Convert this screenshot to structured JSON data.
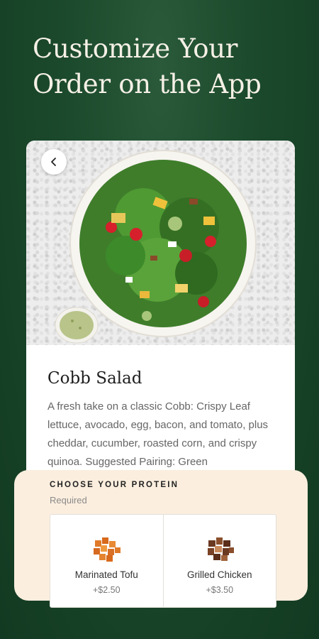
{
  "headline": {
    "line1": "Customize Your",
    "line2": "Order on the App"
  },
  "product": {
    "name": "Cobb Salad",
    "description": "A fresh take on a classic Cobb: Crispy Leaf lettuce, avocado, egg, bacon, and tomato, plus cheddar, cucumber, roasted corn, and crispy quinoa. Suggested Pairing: Green"
  },
  "protein_sheet": {
    "title": "CHOOSE YOUR PROTEIN",
    "required_label": "Required",
    "options": [
      {
        "name": "Marinated Tofu",
        "price": "+$2.50",
        "icon": "tofu-icon"
      },
      {
        "name": "Grilled Chicken",
        "price": "+$3.50",
        "icon": "chicken-icon"
      }
    ]
  },
  "colors": {
    "background": "#1c4a2c",
    "headline_text": "#f5f0e6",
    "sheet_bg": "#fbeede"
  }
}
